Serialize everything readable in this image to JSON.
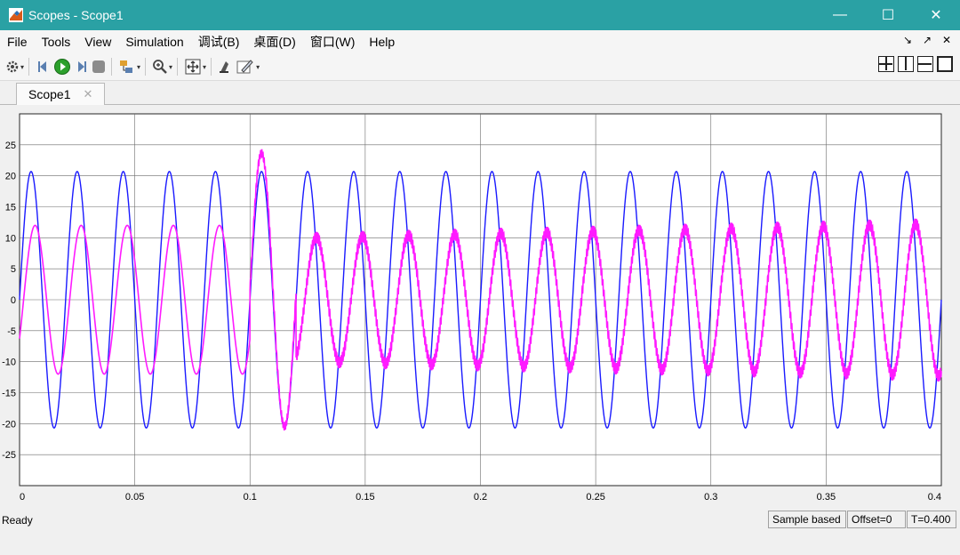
{
  "window": {
    "title": "Scopes - Scope1",
    "minimize": "—",
    "maximize": "☐",
    "close": "✕"
  },
  "menu": {
    "items": [
      "File",
      "Tools",
      "View",
      "Simulation",
      "调试(B)",
      "桌面(D)",
      "窗口(W)",
      "Help"
    ],
    "right": [
      "↘",
      "↗",
      "✕"
    ]
  },
  "toolbar": {
    "icons": [
      "gear-icon",
      "step-back-icon",
      "run-icon",
      "step-forward-icon",
      "stop-icon",
      "signal-builder-icon",
      "zoom-icon",
      "fit-icon",
      "style-icon",
      "pen-icon"
    ]
  },
  "tabs": [
    {
      "label": "Scope1",
      "close": "✕"
    }
  ],
  "status": {
    "ready": "Ready",
    "mode": "Sample based",
    "offset": "Offset=0",
    "time": "T=0.400"
  },
  "colors": {
    "titlebar": "#2aa1a4",
    "series1": "#1a1aff",
    "series2": "#ff1aff",
    "axes_bg": "#ffffff",
    "grid": "#6b6b6b"
  },
  "chart_data": {
    "type": "line",
    "title": "",
    "xlabel": "",
    "ylabel": "",
    "xlim": [
      0,
      0.4
    ],
    "ylim": [
      -30,
      30
    ],
    "xticks": [
      0,
      0.05,
      0.1,
      0.15,
      0.2,
      0.25,
      0.3,
      0.35,
      0.4
    ],
    "xtick_labels": [
      "0",
      "0.05",
      "0.1",
      "0.15",
      "0.2",
      "0.25",
      "0.3",
      "0.35",
      "0.4"
    ],
    "yticks": [
      25,
      20,
      15,
      10,
      5,
      0,
      -5,
      -10,
      -15,
      -20,
      -25
    ],
    "ytick_labels": [
      "25",
      "20",
      "15",
      "10",
      "5",
      "0",
      "-5",
      "-10",
      "-15",
      "-20",
      "-25"
    ],
    "grid": true,
    "series": [
      {
        "color": "#1a1aff",
        "frequency_hz": 50,
        "amplitude": 20.7,
        "phase_rad": 0,
        "samples": [
          [
            0,
            0
          ],
          [
            0.005,
            20.7
          ],
          [
            0.01,
            0
          ],
          [
            0.015,
            -20.7
          ],
          [
            0.02,
            0
          ],
          [
            0.105,
            20.7
          ],
          [
            0.115,
            -20.7
          ],
          [
            0.4,
            0
          ]
        ]
      },
      {
        "color": "#ff1aff",
        "frequency_hz": 50,
        "segments": [
          {
            "t_start": 0,
            "t_end": 0.1,
            "amplitude": 12,
            "phase_rad": -0.55,
            "ripple": 0
          },
          {
            "t_start": 0.1,
            "t_end": 0.12,
            "transient_peak": 23.7,
            "transient_peak_t": 0.105,
            "transient_min": -20.5,
            "transient_min_t": 0.115
          },
          {
            "t_start": 0.12,
            "t_end": 0.4,
            "amplitude_start": 10,
            "amplitude_end": 12.3,
            "phase_rad": -1.2,
            "ripple": 0.9
          }
        ]
      }
    ]
  }
}
